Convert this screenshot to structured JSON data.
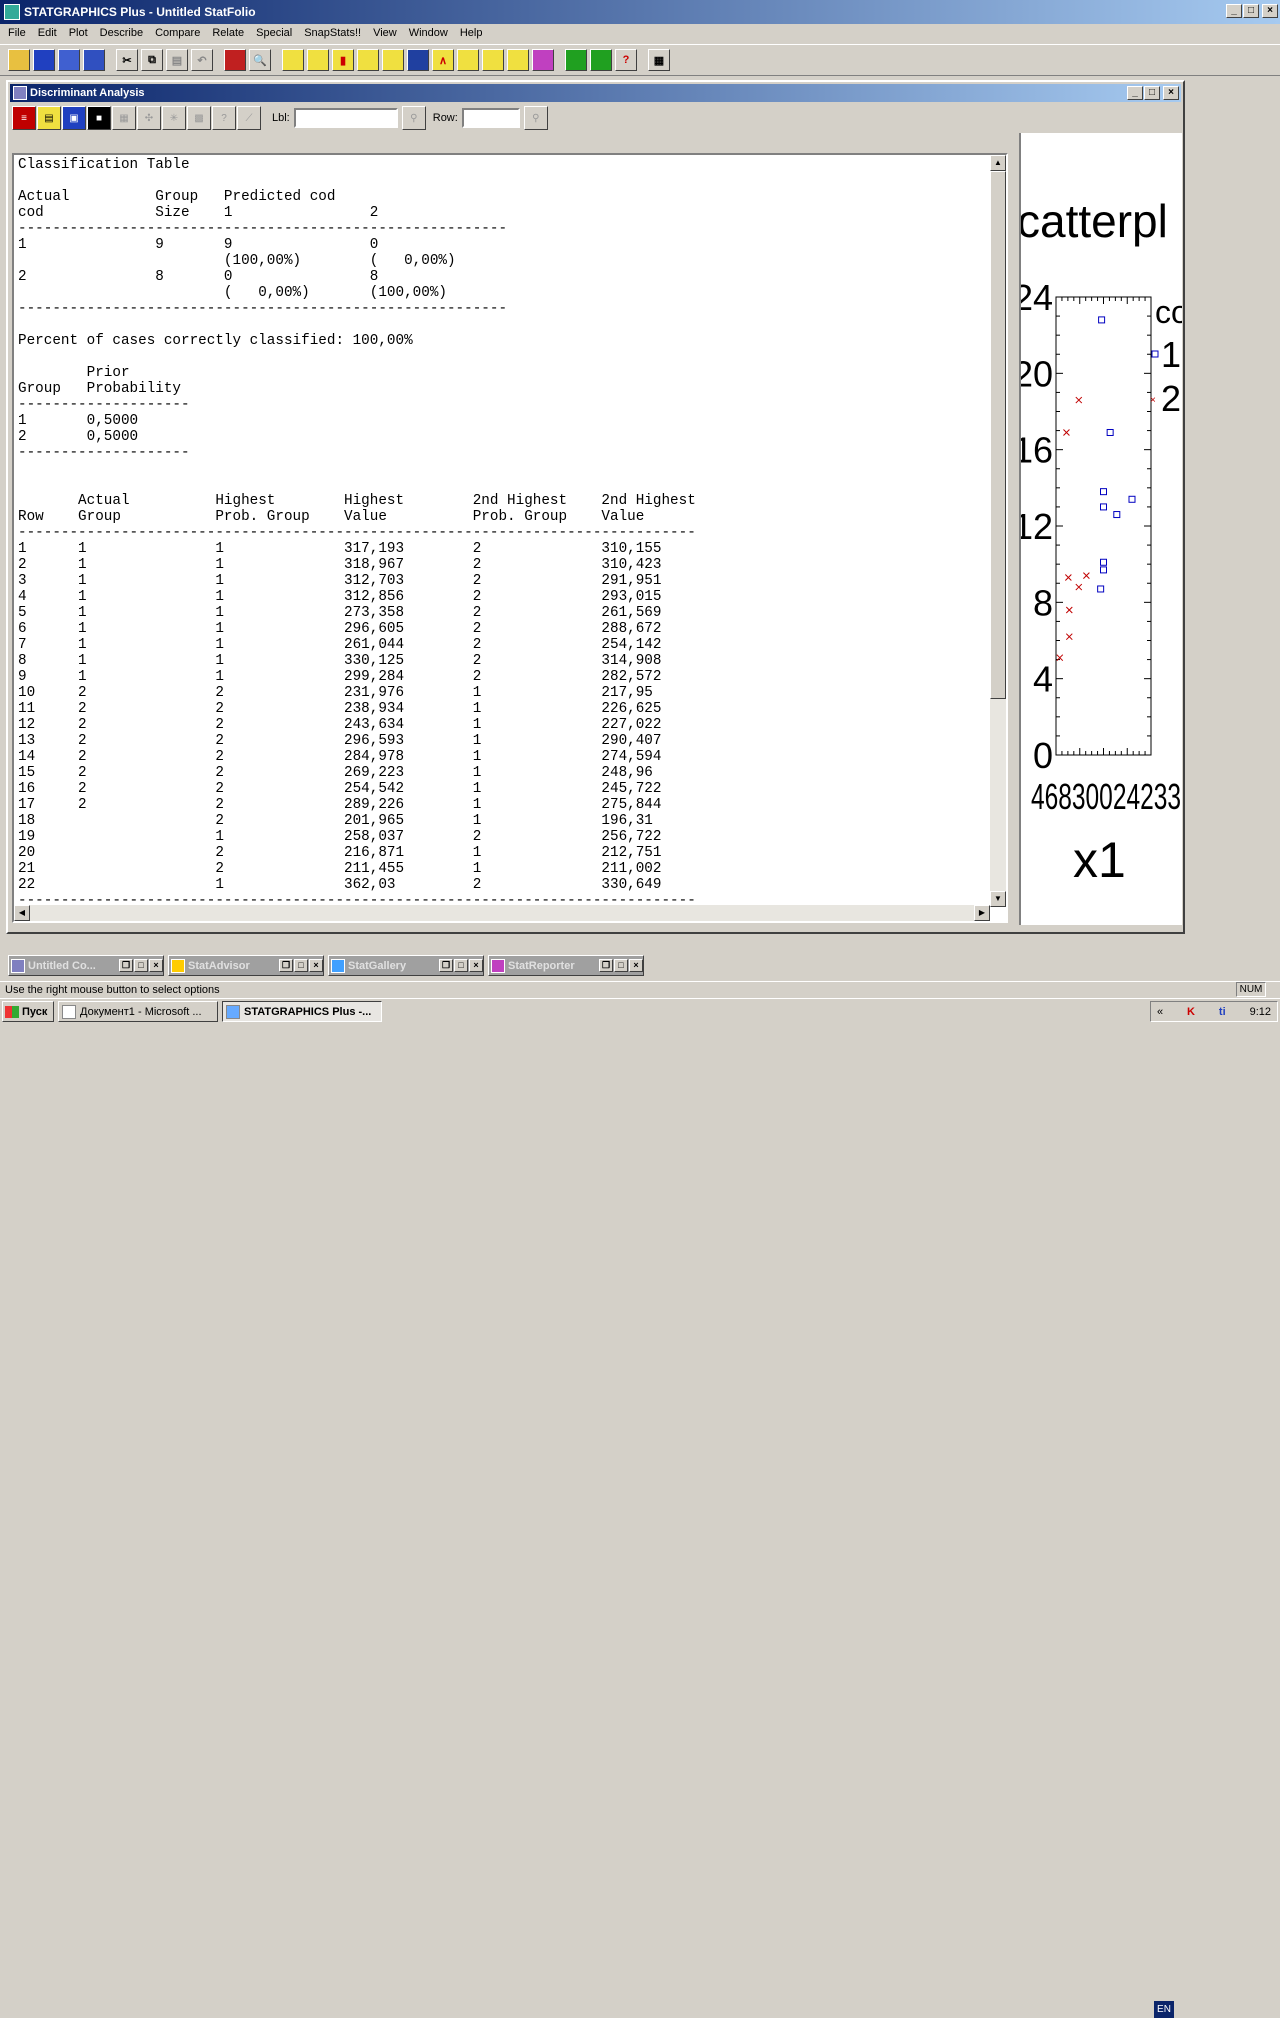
{
  "app": {
    "title": "STATGRAPHICS Plus - Untitled StatFolio",
    "menu": [
      "File",
      "Edit",
      "Plot",
      "Describe",
      "Compare",
      "Relate",
      "Special",
      "SnapStats!!",
      "View",
      "Window",
      "Help"
    ]
  },
  "doc_window": {
    "title": "Discriminant Analysis",
    "lbl_label": "Lbl:",
    "lbl_value": "",
    "row_label": "Row:",
    "row_value": ""
  },
  "output_text": {
    "classification_title": "Classification Table",
    "class_header1": "Actual          Group   Predicted cod",
    "class_header2": "cod             Size    1                2",
    "rule_short": "---------------------------------------------------------",
    "class_row1a": "1               9       9                0",
    "class_row1b": "                        (100,00%)        (   0,00%)",
    "class_row2a": "2               8       0                8",
    "class_row2b": "                        (   0,00%)       (100,00%)",
    "percent_line": "Percent of cases correctly classified: 100,00%",
    "prior_header1": "        Prior",
    "prior_header2": "Group   Probability",
    "rule_prior": "--------------------",
    "prior_rows": [
      "1       0,5000",
      "2       0,5000"
    ],
    "rows_header1": "       Actual          Highest        Highest        2nd Highest    2nd Highest",
    "rows_header2": "Row    Group           Prob. Group    Value          Prob. Group    Value",
    "rule_long": "-------------------------------------------------------------------------------",
    "rows": [
      [
        "1",
        "1",
        "1",
        "317,193",
        "2",
        "310,155"
      ],
      [
        "2",
        "1",
        "1",
        "318,967",
        "2",
        "310,423"
      ],
      [
        "3",
        "1",
        "1",
        "312,703",
        "2",
        "291,951"
      ],
      [
        "4",
        "1",
        "1",
        "312,856",
        "2",
        "293,015"
      ],
      [
        "5",
        "1",
        "1",
        "273,358",
        "2",
        "261,569"
      ],
      [
        "6",
        "1",
        "1",
        "296,605",
        "2",
        "288,672"
      ],
      [
        "7",
        "1",
        "1",
        "261,044",
        "2",
        "254,142"
      ],
      [
        "8",
        "1",
        "1",
        "330,125",
        "2",
        "314,908"
      ],
      [
        "9",
        "1",
        "1",
        "299,284",
        "2",
        "282,572"
      ],
      [
        "10",
        "2",
        "2",
        "231,976",
        "1",
        "217,95"
      ],
      [
        "11",
        "2",
        "2",
        "238,934",
        "1",
        "226,625"
      ],
      [
        "12",
        "2",
        "2",
        "243,634",
        "1",
        "227,022"
      ],
      [
        "13",
        "2",
        "2",
        "296,593",
        "1",
        "290,407"
      ],
      [
        "14",
        "2",
        "2",
        "284,978",
        "1",
        "274,594"
      ],
      [
        "15",
        "2",
        "2",
        "269,223",
        "1",
        "248,96"
      ],
      [
        "16",
        "2",
        "2",
        "254,542",
        "1",
        "245,722"
      ],
      [
        "17",
        "2",
        "2",
        "289,226",
        "1",
        "275,844"
      ],
      [
        "18",
        "",
        "2",
        "201,965",
        "1",
        "196,31"
      ],
      [
        "19",
        "",
        "1",
        "258,037",
        "2",
        "256,722"
      ],
      [
        "20",
        "",
        "2",
        "216,871",
        "1",
        "212,751"
      ],
      [
        "21",
        "",
        "2",
        "211,455",
        "1",
        "211,002"
      ],
      [
        "22",
        "",
        "1",
        "362,03",
        "2",
        "330,649"
      ]
    ]
  },
  "chart_pane": {
    "title_fragment": "catterpl",
    "legend_title_fragment": "co",
    "legend_items": [
      "1",
      "2"
    ],
    "y_ticks": [
      "24",
      "20",
      "16",
      "12",
      "8",
      "4",
      "0"
    ],
    "x_tick_fragment": "46830024233",
    "xlabel": "x1",
    "colors": {
      "group1": "#0000c0",
      "group2": "#c00000"
    }
  },
  "chart_data": {
    "type": "scatter",
    "title": "catterpl",
    "xlabel": "x1",
    "ylabel": "",
    "ylim": [
      0,
      24
    ],
    "series": [
      {
        "name": "1",
        "marker": "square",
        "points": [
          [
            0.48,
            22.8
          ],
          [
            0.57,
            16.9
          ],
          [
            0.5,
            13.8
          ],
          [
            0.5,
            13.0
          ],
          [
            0.64,
            12.6
          ],
          [
            0.8,
            13.4
          ],
          [
            0.5,
            10.1
          ],
          [
            0.5,
            9.7
          ],
          [
            0.47,
            8.7
          ]
        ]
      },
      {
        "name": "2",
        "marker": "x",
        "points": [
          [
            0.24,
            18.6
          ],
          [
            0.11,
            16.9
          ],
          [
            0.13,
            9.3
          ],
          [
            0.24,
            8.8
          ],
          [
            0.32,
            9.4
          ],
          [
            0.14,
            7.6
          ],
          [
            0.14,
            6.2
          ],
          [
            0.04,
            5.1
          ]
        ]
      }
    ]
  },
  "minimized": [
    {
      "label": "Untitled Co...",
      "icon_color": "#8080c0"
    },
    {
      "label": "StatAdvisor",
      "icon_color": "#ffcc00"
    },
    {
      "label": "StatGallery",
      "icon_color": "#40a0ff"
    },
    {
      "label": "StatReporter",
      "icon_color": "#c040c0"
    }
  ],
  "status_text": "Use the right mouse button to select options",
  "num_indicator": "NUM",
  "taskbar": {
    "start": "Пуск",
    "tasks": [
      "Документ1 - Microsoft ...",
      "STATGRAPHICS Plus -..."
    ],
    "lang": "EN",
    "time": "9:12"
  }
}
